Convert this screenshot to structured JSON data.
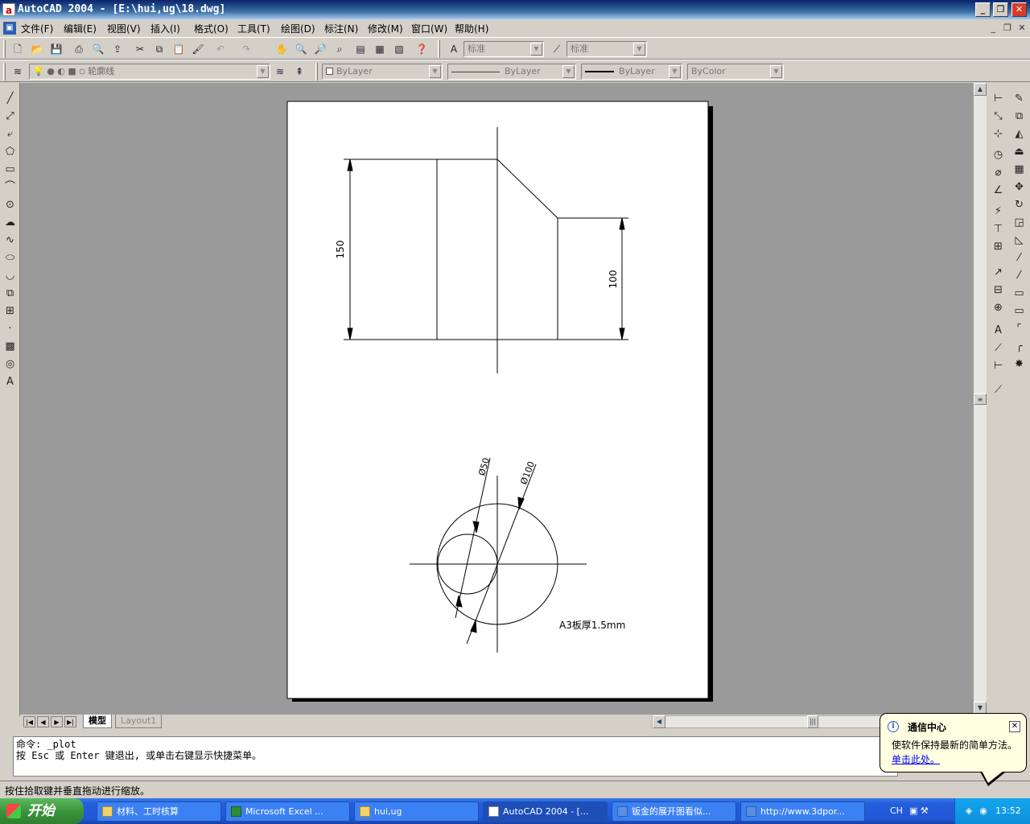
{
  "window": {
    "title": "AutoCAD 2004 - [E:\\hui,ug\\18.dwg]",
    "app_icon": "a"
  },
  "menubar": {
    "items": [
      "文件(F)",
      "编辑(E)",
      "视图(V)",
      "插入(I)",
      "格式(O)",
      "工具(T)",
      "绘图(D)",
      "标注(N)",
      "修改(M)",
      "窗口(W)",
      "帮助(H)"
    ]
  },
  "toolbar1": {
    "text_style": "标准",
    "dim_style": "标准"
  },
  "toolbar2": {
    "layer": "轮廓线",
    "color": "ByLayer",
    "linetype": "ByLayer",
    "lineweight": "ByLayer",
    "plotstyle": "ByColor"
  },
  "drawing": {
    "dim_150": "150",
    "dim_100": "100",
    "dia_50": "Ø50",
    "dia_100": "Ø100",
    "note": "A3板厚1.5mm"
  },
  "tabs": {
    "model": "模型",
    "layout": "Layout1"
  },
  "command": {
    "line1": "命令: _plot",
    "line2": "按 Esc 或 Enter 键退出, 或单击右键显示快捷菜单。"
  },
  "status": {
    "text": "按住拾取键并垂直拖动进行缩放。"
  },
  "balloon": {
    "title": "通信中心",
    "body": "使软件保持最新的简单方法。",
    "link": "单击此处。"
  },
  "taskbar": {
    "start": "开始",
    "tasks": [
      "材料、工时核算",
      "Microsoft Excel ...",
      "hui,ug",
      "AutoCAD 2004 - [...",
      "钣金的展开图看似...",
      "http://www.3dpor..."
    ],
    "lang": "CH",
    "clock": "13:52"
  },
  "colors": {
    "title_start": "#0a246a",
    "canvas": "#9a9a9a",
    "paper": "#ffffff",
    "taskbar": "#245edb"
  }
}
